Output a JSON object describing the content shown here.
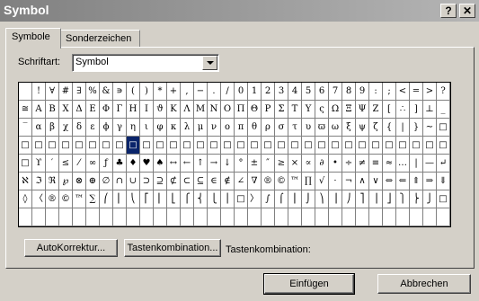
{
  "window": {
    "title": "Symbol",
    "help_glyph": "?",
    "close_glyph": "✕"
  },
  "tabs": [
    {
      "label": "Symbole",
      "active": true
    },
    {
      "label": "Sonderzeichen",
      "active": false
    }
  ],
  "font_field": {
    "label": "Schriftart:",
    "value": "Symbol"
  },
  "symbols": {
    "selected_row": 3,
    "selected_col": 8,
    "rows": [
      [
        "",
        "!",
        "∀",
        "#",
        "∃",
        "%",
        "&",
        "∍",
        "(",
        ")",
        "*",
        "+",
        ",",
        "−",
        ".",
        "/",
        "0",
        "1",
        "2",
        "3",
        "4",
        "5",
        "6",
        "7",
        "8",
        "9",
        ":",
        ";",
        "<",
        "=",
        ">",
        "?"
      ],
      [
        "≅",
        "Α",
        "Β",
        "Χ",
        "Δ",
        "Ε",
        "Φ",
        "Γ",
        "Η",
        "Ι",
        "ϑ",
        "Κ",
        "Λ",
        "Μ",
        "Ν",
        "Ο",
        "Π",
        "Θ",
        "Ρ",
        "Σ",
        "Τ",
        "Υ",
        "ς",
        "Ω",
        "Ξ",
        "Ψ",
        "Ζ",
        "[",
        "∴",
        "]",
        "⊥",
        "_"
      ],
      [
        "‾",
        "α",
        "β",
        "χ",
        "δ",
        "ε",
        "ϕ",
        "γ",
        "η",
        "ι",
        "φ",
        "κ",
        "λ",
        "μ",
        "ν",
        "ο",
        "π",
        "θ",
        "ρ",
        "σ",
        "τ",
        "υ",
        "ϖ",
        "ω",
        "ξ",
        "ψ",
        "ζ",
        "{",
        "|",
        "}",
        "∼",
        "□"
      ],
      [
        "□",
        "□",
        "□",
        "□",
        "□",
        "□",
        "□",
        "□",
        "□",
        "□",
        "□",
        "□",
        "□",
        "□",
        "□",
        "□",
        "□",
        "□",
        "□",
        "□",
        "□",
        "□",
        "□",
        "□",
        "□",
        "□",
        "□",
        "□",
        "□",
        "□",
        "□",
        "□"
      ],
      [
        "□",
        "ϒ",
        "′",
        "≤",
        "⁄",
        "∞",
        "ƒ",
        "♣",
        "♦",
        "♥",
        "♠",
        "↔",
        "←",
        "↑",
        "→",
        "↓",
        "°",
        "±",
        "″",
        "≥",
        "×",
        "∝",
        "∂",
        "•",
        "÷",
        "≠",
        "≡",
        "≈",
        "…",
        "|",
        "—",
        "↵"
      ],
      [
        "ℵ",
        "ℑ",
        "ℜ",
        "℘",
        "⊗",
        "⊕",
        "∅",
        "∩",
        "∪",
        "⊃",
        "⊇",
        "⊄",
        "⊂",
        "⊆",
        "∈",
        "∉",
        "∠",
        "∇",
        "®",
        "©",
        "™",
        "∏",
        "√",
        "⋅",
        "¬",
        "∧",
        "∨",
        "⇔",
        "⇐",
        "⇑",
        "⇒",
        "⇓"
      ],
      [
        "◊",
        "〈",
        "®",
        "©",
        "™",
        "∑",
        "⎛",
        "⎜",
        "⎝",
        "⎡",
        "⎢",
        "⎣",
        "⎧",
        "⎨",
        "⎩",
        "⎪",
        "□",
        "〉",
        "∫",
        "⌠",
        "⎮",
        "⌡",
        "⎞",
        "⎟",
        "⎠",
        "⎤",
        "⎥",
        "⎦",
        "⎫",
        "⎬",
        "⎭",
        "□"
      ],
      [
        "",
        "",
        "",
        "",
        "",
        "",
        "",
        "",
        "",
        "",
        "",
        "",
        "",
        "",
        "",
        "",
        "",
        "",
        "",
        "",
        "",
        "",
        "",
        "",
        "",
        "",
        "",
        "",
        "",
        "",
        "",
        ""
      ]
    ]
  },
  "buttons": {
    "autokorrektur": "AutoKorrektur...",
    "tastenkombination": "Tastenkombination...",
    "tastenkombination_label": "Tastenkombination:",
    "einfuegen": "Einfügen",
    "abbrechen": "Abbrechen"
  },
  "colors": {
    "dialog_bg": "#d4d0c8",
    "titlebar_start": "#808080",
    "selection": "#0a246a"
  }
}
